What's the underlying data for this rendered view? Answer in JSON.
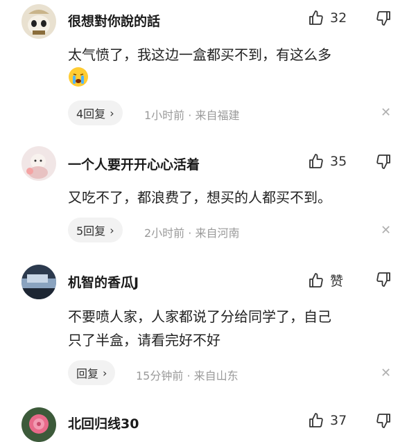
{
  "comments": [
    {
      "username": "很想對你說的話",
      "like_count": "32",
      "text": "太气愤了，我这边一盒都买不到，有这么多",
      "reply_label": "4回复",
      "time": "1小时前",
      "location": "来自福建"
    },
    {
      "username": "一个人要开开心心活着",
      "like_count": "35",
      "text": "又吃不了，都浪费了，想买的人都买不到。",
      "reply_label": "5回复",
      "time": "2小时前",
      "location": "来自河南"
    },
    {
      "username": "机智的香瓜J",
      "like_count": "赞",
      "text_line1": "不要喷人家，人家都说了分给同学了，自己",
      "text_line2": "只了半盒，请看完好不好",
      "reply_label": "回复",
      "time": "15分钟前",
      "location": "来自山东"
    },
    {
      "username": "北回归线30",
      "like_count": "37"
    }
  ],
  "icons": {
    "like": "thumbs-up-icon",
    "dislike": "thumbs-down-icon",
    "chevron": "chevron-right-icon",
    "close": "close-icon",
    "crying_emoji": "crying-emoji-icon"
  },
  "separator": "·"
}
